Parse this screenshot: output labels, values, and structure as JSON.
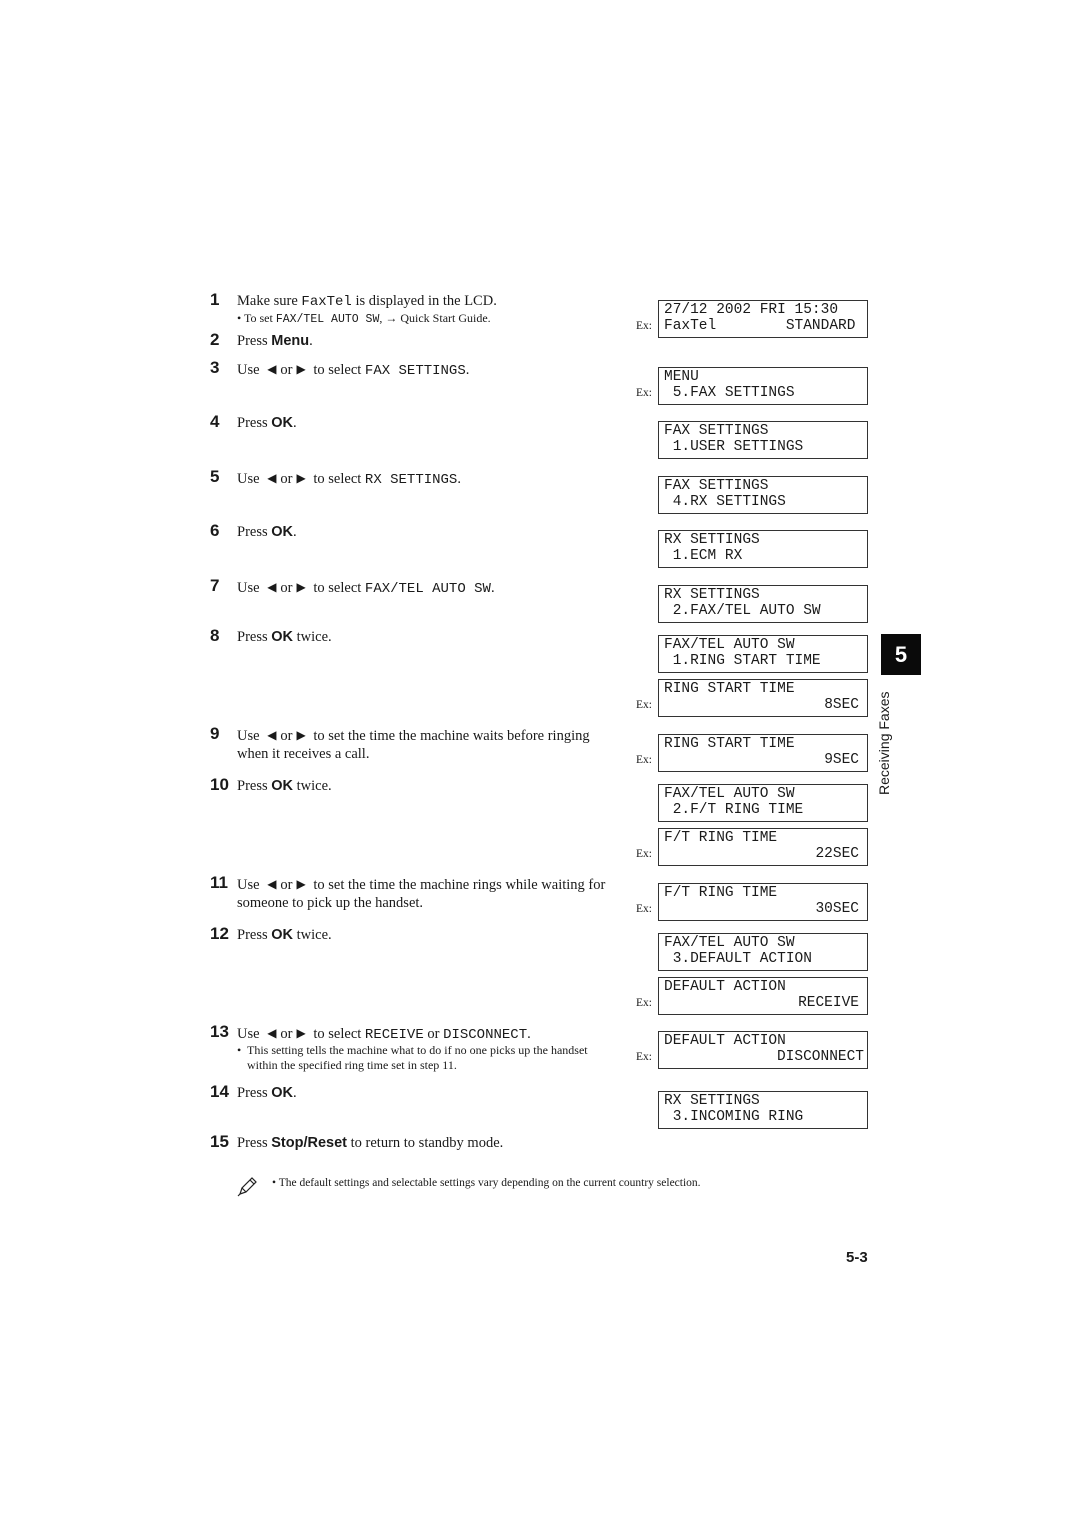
{
  "steps": [
    {
      "num": "1",
      "parts": {
        "a": "Make sure ",
        "code": "FaxTel",
        "b": " is displayed in the LCD."
      },
      "sub": {
        "bullet": "•",
        "a": "To set ",
        "code": "FAX/TEL AUTO SW",
        "b": ", ",
        "arrow": "→",
        "c": " Quick Start Guide."
      }
    },
    {
      "num": "2",
      "a": "Press ",
      "key": "Menu",
      "b": "."
    },
    {
      "num": "3",
      "a": "Use ",
      "left": "◀",
      "or": "or",
      "right": "▶",
      "b": " to select ",
      "code": "FAX SETTINGS",
      "c": "."
    },
    {
      "num": "4",
      "a": "Press ",
      "key": "OK",
      "b": "."
    },
    {
      "num": "5",
      "a": "Use ",
      "left": "◀",
      "or": "or",
      "right": "▶",
      "b": " to select ",
      "code": "RX SETTINGS",
      "c": "."
    },
    {
      "num": "6",
      "a": "Press ",
      "key": "OK",
      "b": "."
    },
    {
      "num": "7",
      "a": "Use ",
      "left": "◀",
      "or": "or",
      "right": "▶",
      "b": " to select ",
      "code": "FAX/TEL AUTO SW",
      "c": "."
    },
    {
      "num": "8",
      "a": "Press ",
      "key": "OK",
      "b": " twice."
    },
    {
      "num": "9",
      "a": "Use ",
      "left": "◀",
      "or": "or",
      "right": "▶",
      "b": " to set the time the machine waits before ringing when it receives a call."
    },
    {
      "num": "10",
      "a": "Press ",
      "key": "OK",
      "b": " twice."
    },
    {
      "num": "11",
      "a": "Use ",
      "left": "◀",
      "or": "or",
      "right": "▶",
      "b": " to set the time the machine rings while waiting for someone to pick up the handset."
    },
    {
      "num": "12",
      "a": "Press ",
      "key": "OK",
      "b": " twice."
    },
    {
      "num": "13",
      "a": "Use ",
      "left": "◀",
      "or": "or",
      "right": "▶",
      "b": " to select ",
      "code": "RECEIVE",
      "c": " or ",
      "code2": "DISCONNECT",
      "d": ".",
      "sub": {
        "bullet": "•",
        "text": "This setting tells the machine what to do if no one picks up the handset within the specified ring time set in step 11."
      }
    },
    {
      "num": "14",
      "a": "Press ",
      "key": "OK",
      "b": "."
    },
    {
      "num": "15",
      "a": "Press ",
      "key": "Stop/Reset",
      "b": " to return to standby mode."
    }
  ],
  "lcds": [
    {
      "ex": "Ex:",
      "l1": "27/12 2002 FRI 15:30",
      "l2": "FaxTel        STANDARD"
    },
    {
      "ex": "Ex:",
      "l1": "MENU",
      "l2": " 5.FAX SETTINGS"
    },
    {
      "ex": "",
      "l1": "FAX SETTINGS",
      "l2": " 1.USER SETTINGS"
    },
    {
      "ex": "",
      "l1": "FAX SETTINGS",
      "l2": " 4.RX SETTINGS"
    },
    {
      "ex": "",
      "l1": "RX SETTINGS",
      "l2": " 1.ECM RX"
    },
    {
      "ex": "",
      "l1": "RX SETTINGS",
      "l2": " 2.FAX/TEL AUTO SW"
    },
    {
      "ex": "",
      "l1": "FAX/TEL AUTO SW",
      "l2": " 1.RING START TIME"
    },
    {
      "ex": "Ex:",
      "l1": "RING START TIME",
      "l2": "8SEC"
    },
    {
      "ex": "Ex:",
      "l1": "RING START TIME",
      "l2": "9SEC"
    },
    {
      "ex": "",
      "l1": "FAX/TEL AUTO SW",
      "l2": " 2.F/T RING TIME"
    },
    {
      "ex": "Ex:",
      "l1": "F/T RING TIME",
      "l2": "22SEC"
    },
    {
      "ex": "Ex:",
      "l1": "F/T RING TIME",
      "l2": "30SEC"
    },
    {
      "ex": "",
      "l1": "FAX/TEL AUTO SW",
      "l2": " 3.DEFAULT ACTION"
    },
    {
      "ex": "Ex:",
      "l1": "DEFAULT ACTION",
      "l2": "RECEIVE"
    },
    {
      "ex": "Ex:",
      "l1": "DEFAULT ACTION",
      "l2": "DISCONNECT"
    },
    {
      "ex": "",
      "l1": "RX SETTINGS",
      "l2": " 3.INCOMING RING"
    }
  ],
  "chapter_tab": {
    "number": "5",
    "title": "Receiving Faxes"
  },
  "note": {
    "icon": "pencil-note-icon",
    "bullet": "•",
    "text": "The default settings and selectable settings vary depending on the current country selection."
  },
  "page_number": "5-3"
}
